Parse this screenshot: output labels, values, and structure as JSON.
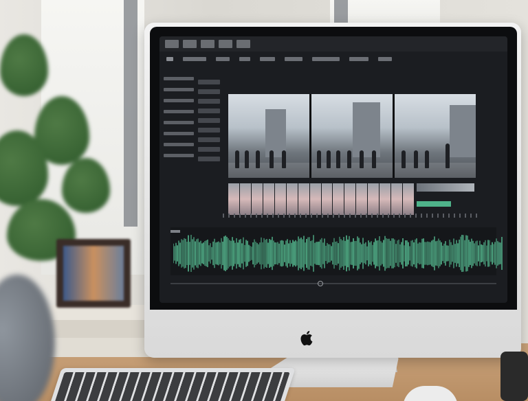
{
  "scene": {
    "description_tags": [
      "monitor",
      "video-editor",
      "desk",
      "plant",
      "keyboard"
    ]
  },
  "icons": {
    "apple": "apple-logo-icon",
    "play": "play-icon"
  },
  "colors": {
    "screen_bg": "#1b1d21",
    "waveform": "#5fd3a2",
    "monitor_body": "#e6e6e6",
    "desk": "#c29a70"
  }
}
